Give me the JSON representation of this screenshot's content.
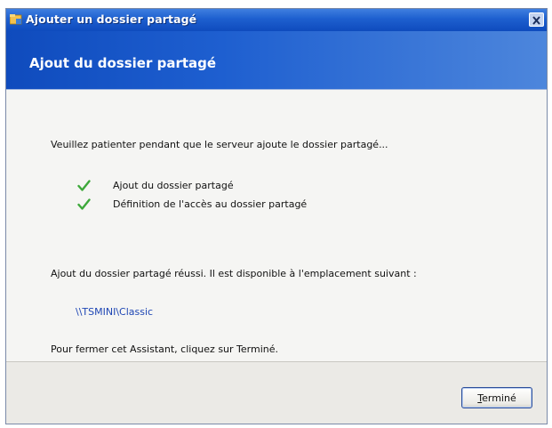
{
  "window": {
    "title": "Ajouter un dossier partagé",
    "close_icon": "close-icon"
  },
  "banner": {
    "title": "Ajout du dossier partagé"
  },
  "content": {
    "intro": "Veuillez patienter pendant que le serveur ajoute le dossier partagé...",
    "steps": [
      {
        "icon": "checkmark-icon",
        "label": "Ajout du dossier partagé"
      },
      {
        "icon": "checkmark-icon",
        "label": "Définition de l'accès au dossier partagé"
      }
    ],
    "success": "Ajout du dossier partagé réussi. Il est disponible à l'emplacement suivant :",
    "path": "\\\\TSMINI\\Classic",
    "close_hint": "Pour fermer cet Assistant, cliquez sur Terminé."
  },
  "footer": {
    "finish_button": {
      "accelerator": "T",
      "rest": "erminé"
    }
  },
  "colors": {
    "title_bar": "#1d5fcf",
    "banner": "#0f4bbd",
    "check": "#3da83a",
    "link": "#1e46b4"
  }
}
